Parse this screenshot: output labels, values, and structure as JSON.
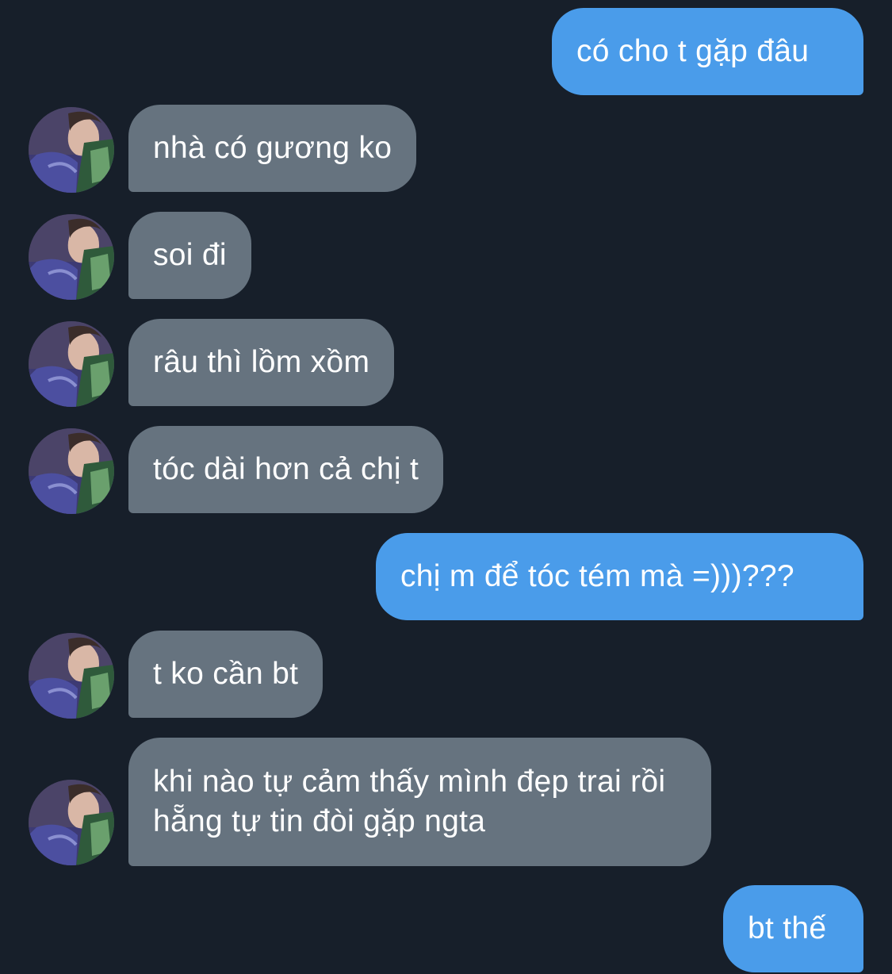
{
  "conversation": {
    "messages": [
      {
        "side": "out",
        "text": "có cho t gặp đâu"
      },
      {
        "side": "in",
        "text": "nhà có gương ko"
      },
      {
        "side": "in",
        "text": "soi đi"
      },
      {
        "side": "in",
        "text": "râu thì lồm xồm"
      },
      {
        "side": "in",
        "text": "tóc dài hơn cả chị t"
      },
      {
        "side": "out",
        "text": "chị m để tóc tém mà =)))???"
      },
      {
        "side": "in",
        "text": "t ko cần bt"
      },
      {
        "side": "in",
        "text": "khi nào tự cảm thấy mình đẹp trai rồi hẵng tự tin đòi gặp ngta"
      },
      {
        "side": "out",
        "text": "bt thế"
      }
    ]
  },
  "colors": {
    "background": "#171f2a",
    "outgoing_bubble": "#4a9cea",
    "incoming_bubble": "#66737f",
    "text": "#ffffff"
  },
  "icons": {
    "avatar": "contact-avatar-photo"
  }
}
